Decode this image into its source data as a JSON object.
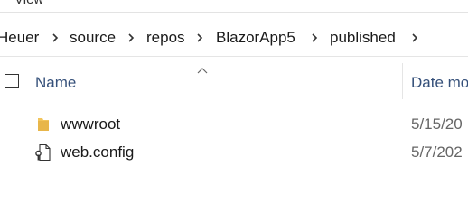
{
  "ribbon": {
    "view_label": "View"
  },
  "breadcrumb": {
    "items": [
      "Heuer",
      "source",
      "repos",
      "BlazorApp5",
      "published"
    ]
  },
  "columns": {
    "name": "Name",
    "date": "Date mo"
  },
  "files": [
    {
      "name": "wwwroot",
      "date": "5/15/20",
      "icon": "folder-icon"
    },
    {
      "name": "web.config",
      "date": "5/7/202",
      "icon": "config-file-icon"
    }
  ],
  "colors": {
    "folder": "#e8b64a",
    "header_text": "#35507a"
  }
}
